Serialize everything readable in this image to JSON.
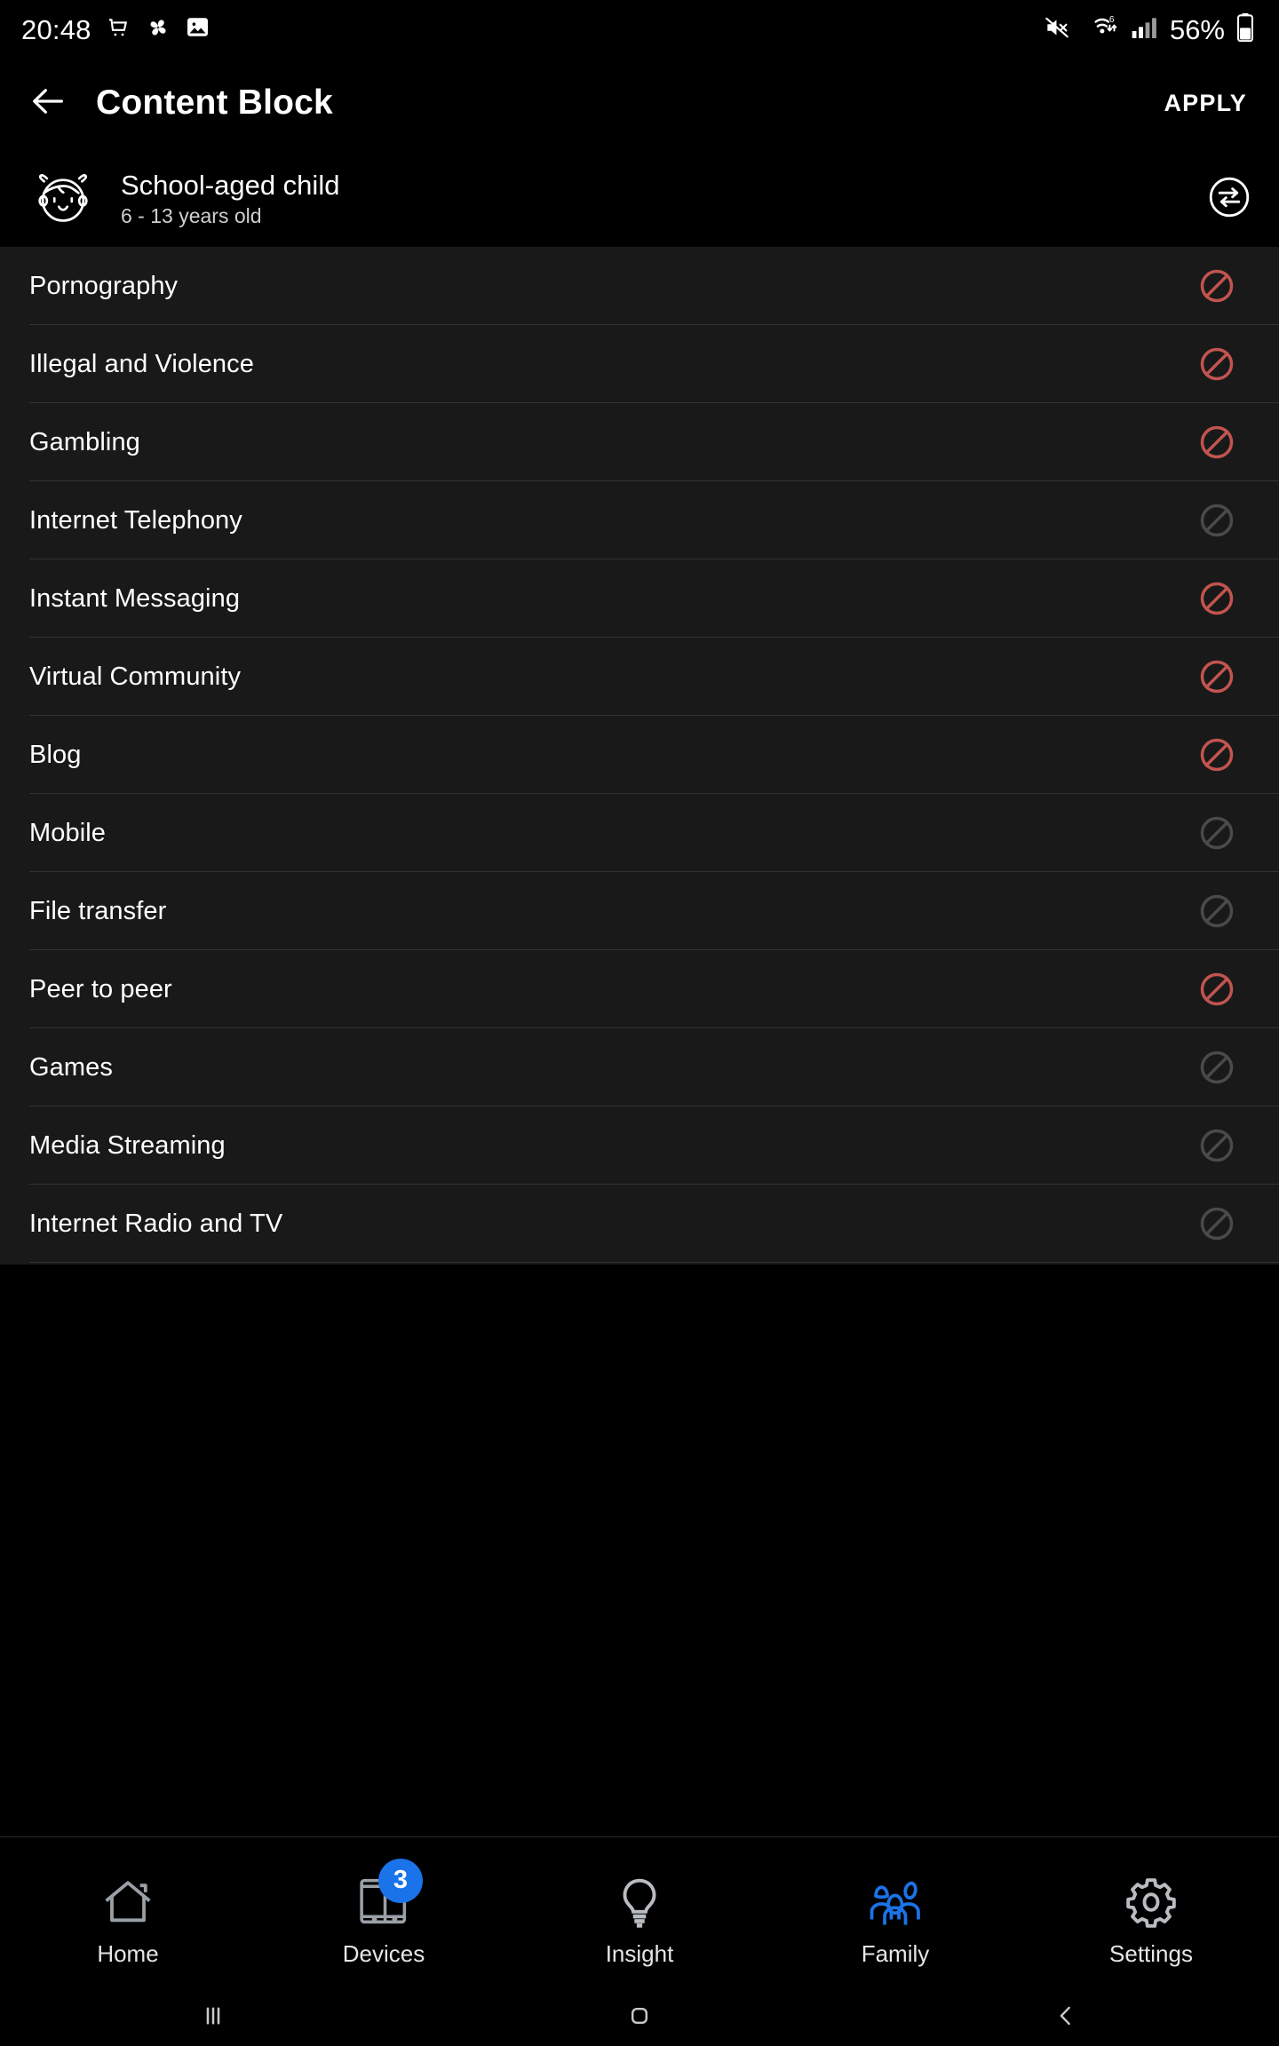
{
  "status_bar": {
    "time": "20:48",
    "battery_percent": "56%",
    "left_icons": [
      "shopping-cart-icon",
      "pinwheel-icon",
      "image-icon"
    ],
    "right_icons": [
      "mute-icon",
      "wifi6-icon",
      "signal-bars-icon",
      "battery-icon"
    ]
  },
  "app_bar": {
    "back_icon": "back-arrow-icon",
    "title": "Content Block",
    "apply_label": "APPLY"
  },
  "profile": {
    "avatar_icon": "child-face-icon",
    "name": "School-aged child",
    "age_range": "6 - 13 years old",
    "swap_icon": "transfer-arrows-icon"
  },
  "colors": {
    "blocked": "#c2544f",
    "allowed": "#4a4a4a",
    "accent": "#1a73e8",
    "panel_bg": "#191919",
    "page_bg": "#000000"
  },
  "content_list": [
    {
      "label": "Pornography",
      "state": "blocked"
    },
    {
      "label": "Illegal and Violence",
      "state": "blocked"
    },
    {
      "label": "Gambling",
      "state": "blocked"
    },
    {
      "label": "Internet Telephony",
      "state": "allowed"
    },
    {
      "label": "Instant Messaging",
      "state": "blocked"
    },
    {
      "label": "Virtual Community",
      "state": "blocked"
    },
    {
      "label": "Blog",
      "state": "blocked"
    },
    {
      "label": "Mobile",
      "state": "allowed"
    },
    {
      "label": "File transfer",
      "state": "allowed"
    },
    {
      "label": "Peer to peer",
      "state": "blocked"
    },
    {
      "label": "Games",
      "state": "allowed"
    },
    {
      "label": "Media Streaming",
      "state": "allowed"
    },
    {
      "label": "Internet Radio and TV",
      "state": "allowed"
    }
  ],
  "bottom_nav": [
    {
      "label": "Home",
      "icon": "home-icon",
      "active": false,
      "badge": ""
    },
    {
      "label": "Devices",
      "icon": "devices-icon",
      "active": false,
      "badge": "3"
    },
    {
      "label": "Insight",
      "icon": "bulb-icon",
      "active": false,
      "badge": ""
    },
    {
      "label": "Family",
      "icon": "family-icon",
      "active": true,
      "badge": ""
    },
    {
      "label": "Settings",
      "icon": "gear-icon",
      "active": false,
      "badge": ""
    }
  ],
  "system_nav": {
    "recents_icon": "recents-icon",
    "home_icon": "home-square-icon",
    "back_icon": "back-chevron-icon"
  }
}
